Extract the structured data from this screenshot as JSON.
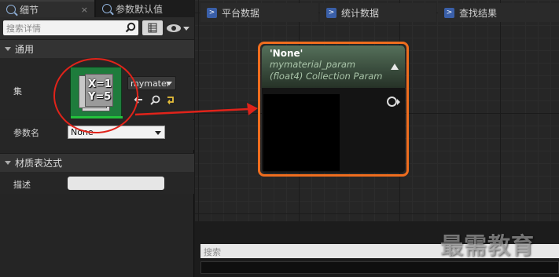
{
  "tabs": {
    "details": "细节",
    "defaults": "参数默认值",
    "close": "×"
  },
  "search": {
    "placeholder": "搜索详情"
  },
  "sections": {
    "general": "通用",
    "material_expression": "材质表达式"
  },
  "rows": {
    "collection_label": "集",
    "collection_value": "mymater",
    "param_name_label": "参数名",
    "param_name_value": "None",
    "description_label": "描述",
    "description_value": ""
  },
  "thumbnail": {
    "line1": "X=1",
    "line2": "Y=5"
  },
  "node": {
    "title": "'None'",
    "subtitle1": "mymaterial_param",
    "subtitle2": "(float4) Collection Param"
  },
  "bottom": {
    "tabs": [
      "平台数据",
      "统计数据",
      "查找结果"
    ],
    "search_placeholder": "搜索"
  },
  "watermark": "最需教育",
  "colors": {
    "selection_outline": "#ef6d1e",
    "annotation": "#e0231a",
    "thumbnail_bg": "#1e7c3c"
  }
}
